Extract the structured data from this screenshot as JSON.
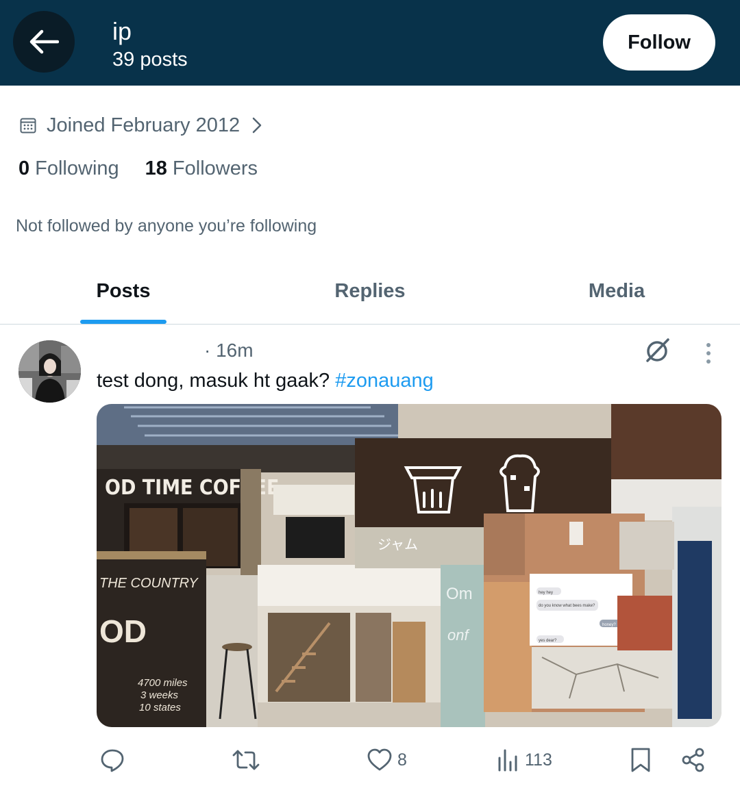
{
  "header": {
    "name": "ip",
    "posts_count": "39 posts",
    "follow_label": "Follow"
  },
  "profile": {
    "joined": "Joined February 2012",
    "following_count": "0",
    "following_label": "Following",
    "followers_count": "18",
    "followers_label": "Followers",
    "not_followed_text": "Not followed by anyone you’re following"
  },
  "tabs": [
    {
      "label": "Posts",
      "active": true
    },
    {
      "label": "Replies",
      "active": false
    },
    {
      "label": "Media",
      "active": false
    }
  ],
  "post": {
    "time": "· 16m",
    "text": "test dong, masuk ht gaak? ",
    "hashtag": "#zonauang",
    "media": {
      "sign_text": "OD TIME COFFEE",
      "chat_lines": [
        "hey hey",
        "do you know what bees make?",
        "honey?",
        "yes dear?"
      ]
    },
    "actions": {
      "likes": "8",
      "views": "113"
    }
  },
  "colors": {
    "header_bg": "#08324a",
    "accent": "#1d9bf0",
    "secondary_text": "#536471"
  }
}
